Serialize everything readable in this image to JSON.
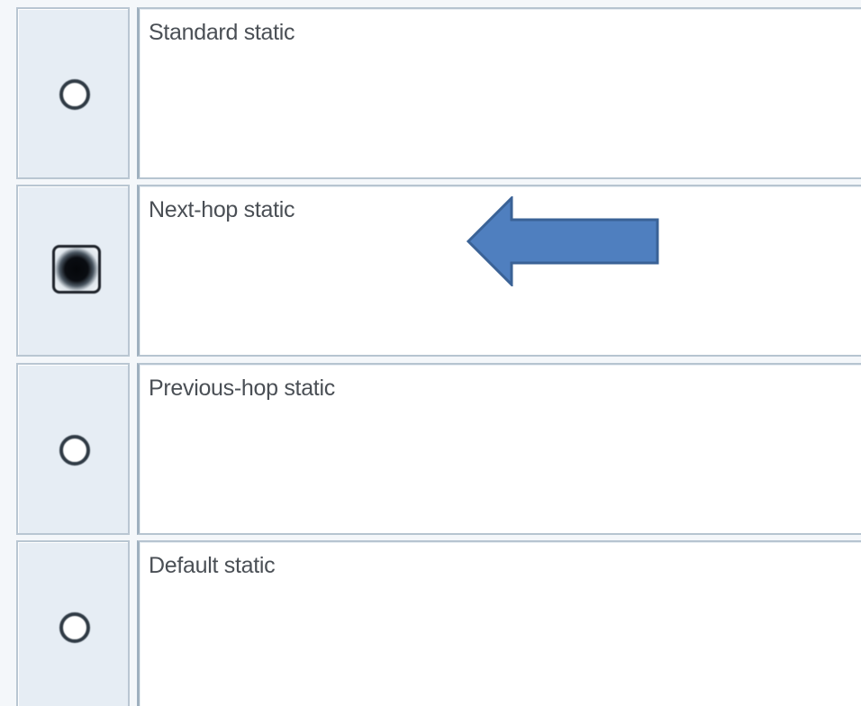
{
  "routing_options": {
    "items": [
      {
        "label": "Standard static",
        "selected": false
      },
      {
        "label": "Next-hop static",
        "selected": true
      },
      {
        "label": "Previous-hop static",
        "selected": false
      },
      {
        "label": "Default static",
        "selected": false
      }
    ]
  },
  "colors": {
    "arrow_fill": "#4f7fbf",
    "arrow_stroke": "#3a6296",
    "radio_cell_bg": "#e6edf4",
    "label_cell_bg": "#ffffff",
    "label_text": "#4a4f55"
  },
  "annotation": {
    "icon": "left-arrow-icon",
    "points_to_item": "Next-hop static"
  }
}
